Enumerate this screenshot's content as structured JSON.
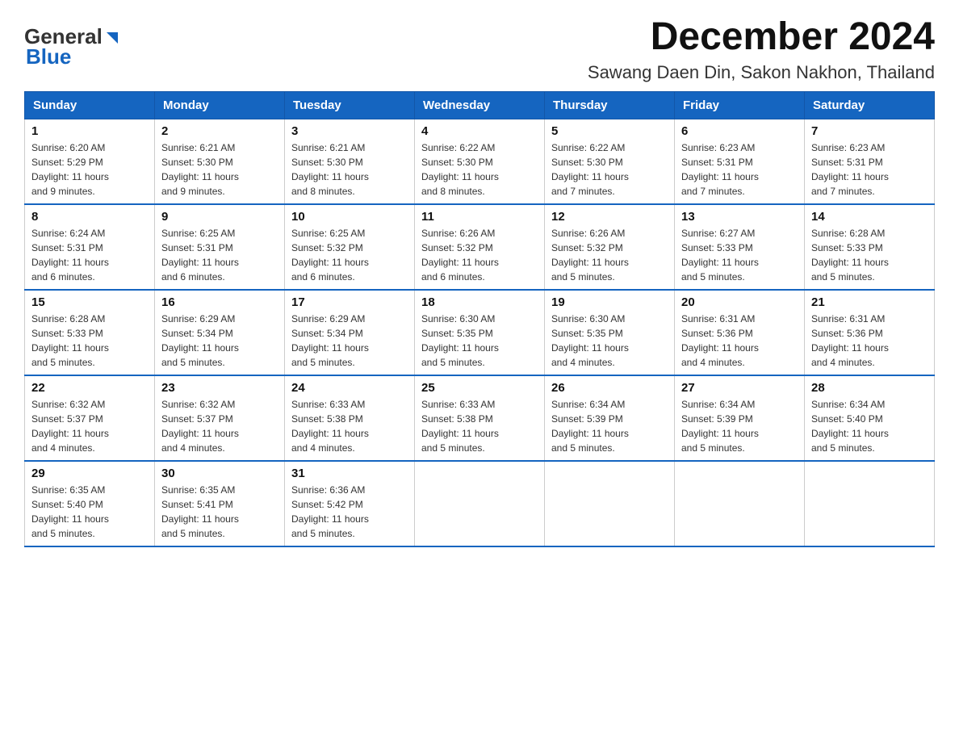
{
  "logo": {
    "text_general": "General",
    "text_blue": "Blue"
  },
  "title": "December 2024",
  "subtitle": "Sawang Daen Din, Sakon Nakhon, Thailand",
  "days_of_week": [
    "Sunday",
    "Monday",
    "Tuesday",
    "Wednesday",
    "Thursday",
    "Friday",
    "Saturday"
  ],
  "weeks": [
    [
      {
        "day": "1",
        "sunrise": "6:20 AM",
        "sunset": "5:29 PM",
        "daylight": "11 hours and 9 minutes."
      },
      {
        "day": "2",
        "sunrise": "6:21 AM",
        "sunset": "5:30 PM",
        "daylight": "11 hours and 9 minutes."
      },
      {
        "day": "3",
        "sunrise": "6:21 AM",
        "sunset": "5:30 PM",
        "daylight": "11 hours and 8 minutes."
      },
      {
        "day": "4",
        "sunrise": "6:22 AM",
        "sunset": "5:30 PM",
        "daylight": "11 hours and 8 minutes."
      },
      {
        "day": "5",
        "sunrise": "6:22 AM",
        "sunset": "5:30 PM",
        "daylight": "11 hours and 7 minutes."
      },
      {
        "day": "6",
        "sunrise": "6:23 AM",
        "sunset": "5:31 PM",
        "daylight": "11 hours and 7 minutes."
      },
      {
        "day": "7",
        "sunrise": "6:23 AM",
        "sunset": "5:31 PM",
        "daylight": "11 hours and 7 minutes."
      }
    ],
    [
      {
        "day": "8",
        "sunrise": "6:24 AM",
        "sunset": "5:31 PM",
        "daylight": "11 hours and 6 minutes."
      },
      {
        "day": "9",
        "sunrise": "6:25 AM",
        "sunset": "5:31 PM",
        "daylight": "11 hours and 6 minutes."
      },
      {
        "day": "10",
        "sunrise": "6:25 AM",
        "sunset": "5:32 PM",
        "daylight": "11 hours and 6 minutes."
      },
      {
        "day": "11",
        "sunrise": "6:26 AM",
        "sunset": "5:32 PM",
        "daylight": "11 hours and 6 minutes."
      },
      {
        "day": "12",
        "sunrise": "6:26 AM",
        "sunset": "5:32 PM",
        "daylight": "11 hours and 5 minutes."
      },
      {
        "day": "13",
        "sunrise": "6:27 AM",
        "sunset": "5:33 PM",
        "daylight": "11 hours and 5 minutes."
      },
      {
        "day": "14",
        "sunrise": "6:28 AM",
        "sunset": "5:33 PM",
        "daylight": "11 hours and 5 minutes."
      }
    ],
    [
      {
        "day": "15",
        "sunrise": "6:28 AM",
        "sunset": "5:33 PM",
        "daylight": "11 hours and 5 minutes."
      },
      {
        "day": "16",
        "sunrise": "6:29 AM",
        "sunset": "5:34 PM",
        "daylight": "11 hours and 5 minutes."
      },
      {
        "day": "17",
        "sunrise": "6:29 AM",
        "sunset": "5:34 PM",
        "daylight": "11 hours and 5 minutes."
      },
      {
        "day": "18",
        "sunrise": "6:30 AM",
        "sunset": "5:35 PM",
        "daylight": "11 hours and 5 minutes."
      },
      {
        "day": "19",
        "sunrise": "6:30 AM",
        "sunset": "5:35 PM",
        "daylight": "11 hours and 4 minutes."
      },
      {
        "day": "20",
        "sunrise": "6:31 AM",
        "sunset": "5:36 PM",
        "daylight": "11 hours and 4 minutes."
      },
      {
        "day": "21",
        "sunrise": "6:31 AM",
        "sunset": "5:36 PM",
        "daylight": "11 hours and 4 minutes."
      }
    ],
    [
      {
        "day": "22",
        "sunrise": "6:32 AM",
        "sunset": "5:37 PM",
        "daylight": "11 hours and 4 minutes."
      },
      {
        "day": "23",
        "sunrise": "6:32 AM",
        "sunset": "5:37 PM",
        "daylight": "11 hours and 4 minutes."
      },
      {
        "day": "24",
        "sunrise": "6:33 AM",
        "sunset": "5:38 PM",
        "daylight": "11 hours and 4 minutes."
      },
      {
        "day": "25",
        "sunrise": "6:33 AM",
        "sunset": "5:38 PM",
        "daylight": "11 hours and 5 minutes."
      },
      {
        "day": "26",
        "sunrise": "6:34 AM",
        "sunset": "5:39 PM",
        "daylight": "11 hours and 5 minutes."
      },
      {
        "day": "27",
        "sunrise": "6:34 AM",
        "sunset": "5:39 PM",
        "daylight": "11 hours and 5 minutes."
      },
      {
        "day": "28",
        "sunrise": "6:34 AM",
        "sunset": "5:40 PM",
        "daylight": "11 hours and 5 minutes."
      }
    ],
    [
      {
        "day": "29",
        "sunrise": "6:35 AM",
        "sunset": "5:40 PM",
        "daylight": "11 hours and 5 minutes."
      },
      {
        "day": "30",
        "sunrise": "6:35 AM",
        "sunset": "5:41 PM",
        "daylight": "11 hours and 5 minutes."
      },
      {
        "day": "31",
        "sunrise": "6:36 AM",
        "sunset": "5:42 PM",
        "daylight": "11 hours and 5 minutes."
      },
      null,
      null,
      null,
      null
    ]
  ],
  "labels": {
    "sunrise": "Sunrise:",
    "sunset": "Sunset:",
    "daylight": "Daylight:"
  }
}
